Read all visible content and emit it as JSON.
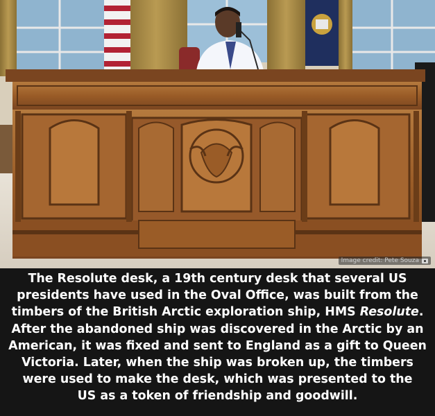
{
  "photo": {
    "alt_subject": "Resolute desk in the Oval Office",
    "credit": "Image credit: Pete Souza",
    "credit_icon": "camera-icon"
  },
  "caption": {
    "line1": "The Resolute desk, a 19th century desk that several US",
    "line2": "presidents have used in the Oval Office, was built from the",
    "line3_start": "timbers of the British Arctic exploration ship, HMS ",
    "line3_ship": "Resolute",
    "line3_end": ".",
    "line4": "After the abandoned ship was discovered in the Arctic by an",
    "line5": "American, it was fixed and sent to England as a gift to Queen",
    "line6": "Victoria. Later, when the ship was broken up, the timbers",
    "line7": "were used to make the desk, which was presented to the",
    "line8": "US as a token of friendship and goodwill."
  },
  "colors": {
    "wood_dark": "#6b3d18",
    "wood_mid": "#9a5c27",
    "wood_light": "#c58a48",
    "caption_bg": "#151515",
    "caption_text": "#ffffff"
  }
}
